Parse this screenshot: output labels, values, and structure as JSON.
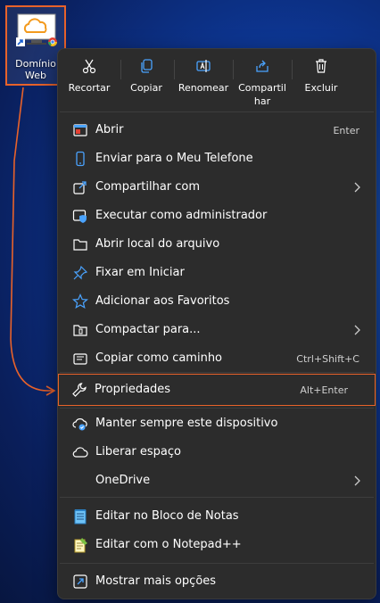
{
  "desktop": {
    "icon_label_line1": "Domínio",
    "icon_label_line2": "Web"
  },
  "toolbar": {
    "cut_label": "Recortar",
    "copy_label": "Copiar",
    "rename_label": "Renomear",
    "share_label_line1": "Compartil",
    "share_label_line2": "har",
    "delete_label": "Excluir"
  },
  "menu": {
    "items": [
      {
        "label": "Abrir",
        "shortcut": "Enter"
      },
      {
        "label": "Enviar para o Meu Telefone"
      },
      {
        "label": "Compartilhar com"
      },
      {
        "label": "Executar como administrador"
      },
      {
        "label": "Abrir local do arquivo"
      },
      {
        "label": "Fixar em Iniciar"
      },
      {
        "label": "Adicionar aos Favoritos"
      },
      {
        "label": "Compactar para..."
      },
      {
        "label": "Copiar como caminho",
        "shortcut": "Ctrl+Shift+C"
      },
      {
        "label": "Propriedades",
        "shortcut": "Alt+Enter"
      },
      {
        "label": "Manter sempre este dispositivo"
      },
      {
        "label": "Liberar espaço"
      },
      {
        "label": "OneDrive"
      },
      {
        "label": "Editar no Bloco de Notas"
      },
      {
        "label": "Editar com o Notepad++"
      },
      {
        "label": "Mostrar mais opções"
      }
    ]
  },
  "colors": {
    "highlight": "#e8622a",
    "menu_bg": "#2c2c2c",
    "accent_blue": "#4aa3ff"
  }
}
